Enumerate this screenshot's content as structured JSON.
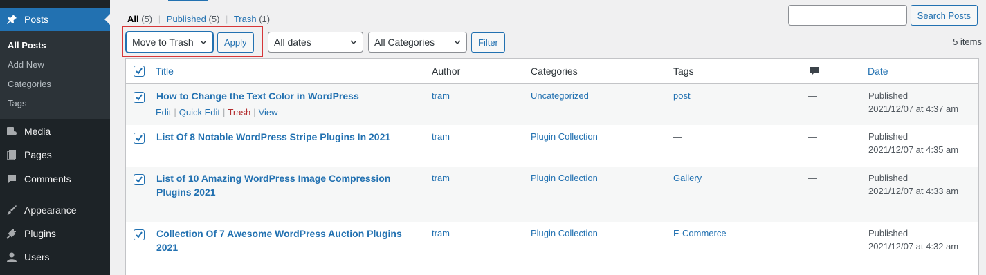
{
  "sidebar": {
    "posts": "Posts",
    "submenu": [
      "All Posts",
      "Add New",
      "Categories",
      "Tags"
    ],
    "media": "Media",
    "pages": "Pages",
    "comments": "Comments",
    "appearance": "Appearance",
    "plugins": "Plugins",
    "users": "Users"
  },
  "views": {
    "all": "All",
    "all_count": "(5)",
    "published": "Published",
    "published_count": "(5)",
    "trash": "Trash",
    "trash_count": "(1)",
    "separator": "|"
  },
  "search": {
    "button": "Search Posts",
    "value": ""
  },
  "bulk": {
    "action": "Move to Trash",
    "apply": "Apply"
  },
  "filters": {
    "dates": "All dates",
    "categories": "All Categories",
    "filter": "Filter"
  },
  "items_count": "5 items",
  "table": {
    "headers": {
      "title": "Title",
      "author": "Author",
      "categories": "Categories",
      "tags": "Tags",
      "date": "Date"
    },
    "row_actions": [
      "Edit",
      "Quick Edit",
      "Trash",
      "View"
    ],
    "row_action_sep": "|",
    "rows": [
      {
        "title": "How to Change the Text Color in WordPress",
        "author": "tram",
        "categories": "Uncategorized",
        "tags": "post",
        "comments": "—",
        "status": "Published",
        "date": "2021/12/07 at 4:37 am"
      },
      {
        "title": "List Of 8 Notable WordPress Stripe Plugins In 2021",
        "author": "tram",
        "categories": "Plugin Collection",
        "tags": "—",
        "comments": "—",
        "status": "Published",
        "date": "2021/12/07 at 4:35 am"
      },
      {
        "title": "List of 10 Amazing WordPress Image Compression Plugins 2021",
        "author": "tram",
        "categories": "Plugin Collection",
        "tags": "Gallery",
        "comments": "—",
        "status": "Published",
        "date": "2021/12/07 at 4:33 am"
      },
      {
        "title": "Collection Of 7 Awesome WordPress Auction Plugins 2021",
        "author": "tram",
        "categories": "Plugin Collection",
        "tags": "E-Commerce",
        "comments": "—",
        "status": "Published",
        "date": "2021/12/07 at 4:32 am"
      }
    ]
  },
  "colors": {
    "accent": "#2271b1",
    "sidebar": "#1d2327",
    "highlight": "#d63638"
  }
}
